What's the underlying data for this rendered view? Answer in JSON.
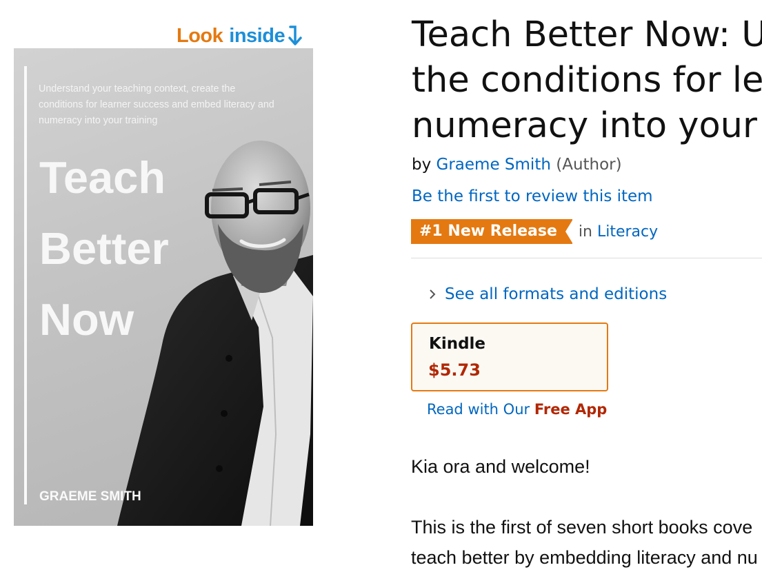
{
  "look_inside": {
    "word1": "Look",
    "word2": "inside"
  },
  "cover": {
    "subtitle_lines": [
      "Understand your teaching context, create the",
      "conditions for learner success and embed literacy and",
      "numeracy into your training"
    ],
    "title_lines": [
      "Teach",
      "Better",
      "Now"
    ],
    "author": "GRAEME SMITH"
  },
  "product": {
    "title_lines": [
      "Teach Better Now: U",
      "the conditions for le",
      "numeracy into your"
    ],
    "by": "by",
    "author": "Graeme Smith",
    "author_role": "(Author)",
    "review_link": "Be the first to review this item",
    "badge": {
      "label": "#1 New Release",
      "in": "in",
      "category": "Literacy"
    },
    "formats_link": "See all formats and editions",
    "kindle": {
      "format": "Kindle",
      "price": "$5.73"
    },
    "read_app": {
      "prefix": "Read with Our",
      "highlight": "Free App"
    },
    "description": [
      "Kia ora and welcome!",
      "This is the first of seven short books cove",
      "teach better by embedding literacy and nu"
    ]
  },
  "colors": {
    "link": "#0066c0",
    "badge": "#e47911",
    "price": "#b12704",
    "look_inside_orange": "#e47911",
    "look_inside_blue": "#1d8fd8"
  },
  "icons": [
    "down-arrow-icon",
    "chevron-right-icon"
  ]
}
